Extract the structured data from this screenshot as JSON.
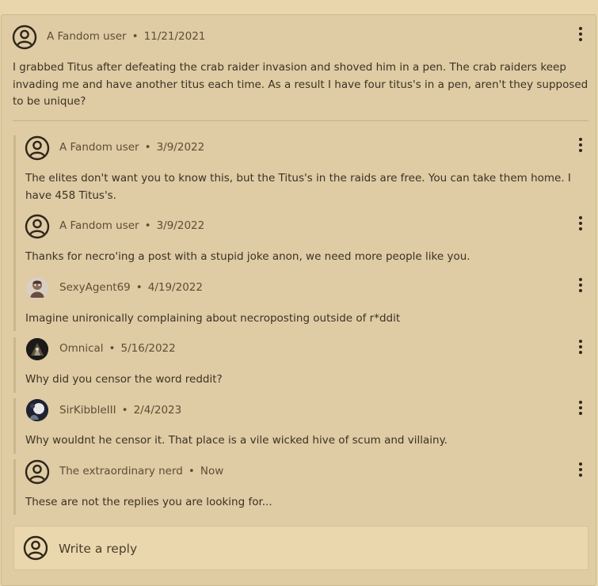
{
  "thread": {
    "post": {
      "author": "A Fandom user",
      "date": "11/21/2021",
      "body": "I grabbed Titus after defeating the crab raider invasion and shoved him in a pen. The crab raiders keep invading me and have another titus each time. As a result I have four titus's in a pen, aren't they supposed to be unique?"
    },
    "replies": [
      {
        "author": "A Fandom user",
        "date": "3/9/2022",
        "body": "The elites don't want you to know this, but the Titus's in the raids are free. You can take them home. I have 458 Titus's."
      },
      {
        "author": "A Fandom user",
        "date": "3/9/2022",
        "body": "Thanks for necro'ing a post with a stupid joke anon, we need more people like you."
      },
      {
        "author": "SexyAgent69",
        "date": "4/19/2022",
        "body": "Imagine unironically complaining about necroposting outside of r*ddit"
      },
      {
        "author": "Omnical",
        "date": "5/16/2022",
        "body": "Why did you censor the word reddit?"
      },
      {
        "author": "SirKibbleIII",
        "date": "2/4/2023",
        "body": "Why wouldnt he censor it. That place is a vile wicked hive of scum and villainy."
      },
      {
        "author": "The extraordinary nerd",
        "date": "Now",
        "body": "These are not the replies you are looking for..."
      }
    ],
    "separator": "•",
    "reply_placeholder": "Write a reply"
  },
  "icons": {
    "default_avatar": "user-circle-icon",
    "menu": "kebab-menu-icon"
  },
  "colors": {
    "background": "#e9d6ac",
    "card": "#dfcba4",
    "text": "#3c3223",
    "meta": "#5e4e34"
  }
}
